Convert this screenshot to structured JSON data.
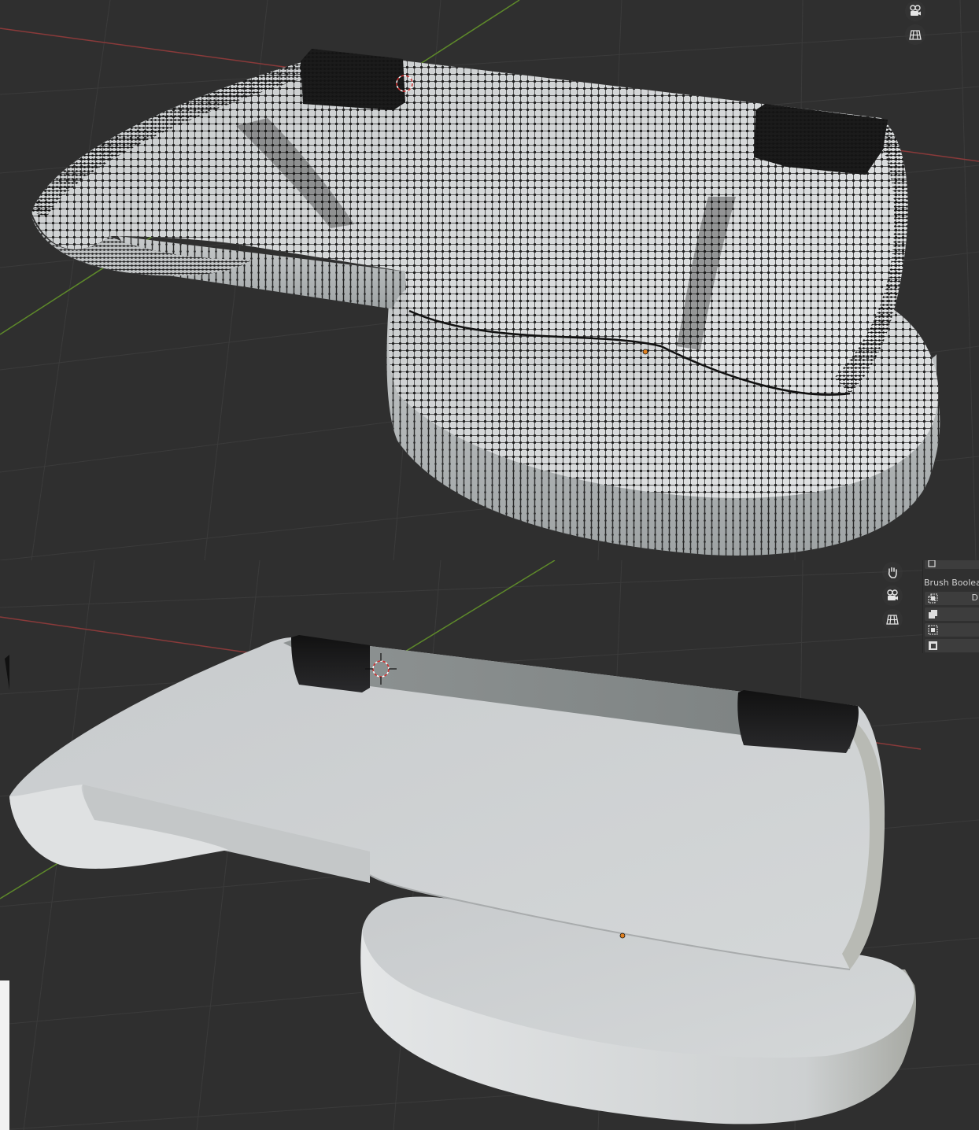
{
  "viewports": {
    "top": {
      "shading": "wireframe-over-solid",
      "nav_icons": [
        "camera-icon",
        "grid-icon"
      ]
    },
    "bottom": {
      "shading": "solid",
      "nav_icons": [
        "hand-icon",
        "camera-icon",
        "grid-icon"
      ],
      "properties_panel": {
        "header": "Brush Boolean",
        "rows": [
          {
            "icon": "intersect-icon",
            "value": "D"
          },
          {
            "icon": "union-icon",
            "value": ""
          },
          {
            "icon": "difference-icon",
            "value": ""
          },
          {
            "icon": "slice-icon",
            "value": ""
          }
        ]
      }
    }
  },
  "colors": {
    "background": "#2f2f2f",
    "grid_line": "#3a3a3a",
    "x_axis": "#8a3a3a",
    "y_axis": "#5e8a2a",
    "mesh_light": "#d8dadb",
    "mesh_shadow": "#8a8f90",
    "cursor_red": "#d03030",
    "origin_orange": "#e08020"
  }
}
